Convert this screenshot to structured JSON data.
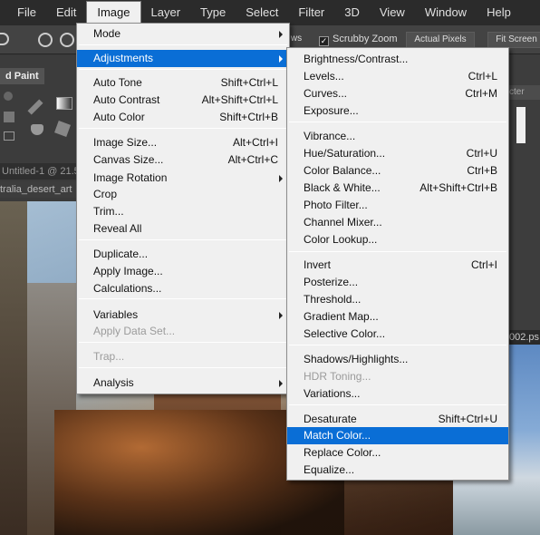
{
  "menubar": {
    "items": [
      "File",
      "Edit",
      "Image",
      "Layer",
      "Type",
      "Select",
      "Filter",
      "3D",
      "View",
      "Window",
      "Help"
    ],
    "open_index": 2
  },
  "options": {
    "fit_label": "ws",
    "scrubby_zoom": "Scrubby Zoom",
    "scrubby_checked": true,
    "actual_pixels": "Actual Pixels",
    "fit_screen": "Fit Screen"
  },
  "left_panel": {
    "tab_label": "d Paint"
  },
  "documents": {
    "tab1": "Untitled-1 @ 21.5",
    "tab2": "tralia_desert_art",
    "right_tab": "002.ps",
    "right_panel_label": "cter"
  },
  "image_menu": {
    "items": [
      {
        "label": "Mode",
        "shortcut": "",
        "submenu": true,
        "disabled": false,
        "highlighted": false
      },
      {
        "label": "Adjustments",
        "shortcut": "",
        "submenu": true,
        "disabled": false,
        "highlighted": true
      },
      {
        "label": "Auto Tone",
        "shortcut": "Shift+Ctrl+L",
        "submenu": false,
        "disabled": false,
        "highlighted": false
      },
      {
        "label": "Auto Contrast",
        "shortcut": "Alt+Shift+Ctrl+L",
        "submenu": false,
        "disabled": false,
        "highlighted": false
      },
      {
        "label": "Auto Color",
        "shortcut": "Shift+Ctrl+B",
        "submenu": false,
        "disabled": false,
        "highlighted": false
      },
      {
        "label": "Image Size...",
        "shortcut": "Alt+Ctrl+I",
        "submenu": false,
        "disabled": false,
        "highlighted": false
      },
      {
        "label": "Canvas Size...",
        "shortcut": "Alt+Ctrl+C",
        "submenu": false,
        "disabled": false,
        "highlighted": false
      },
      {
        "label": "Image Rotation",
        "shortcut": "",
        "submenu": true,
        "disabled": false,
        "highlighted": false
      },
      {
        "label": "Crop",
        "shortcut": "",
        "submenu": false,
        "disabled": false,
        "highlighted": false
      },
      {
        "label": "Trim...",
        "shortcut": "",
        "submenu": false,
        "disabled": false,
        "highlighted": false
      },
      {
        "label": "Reveal All",
        "shortcut": "",
        "submenu": false,
        "disabled": false,
        "highlighted": false
      },
      {
        "label": "Duplicate...",
        "shortcut": "",
        "submenu": false,
        "disabled": false,
        "highlighted": false
      },
      {
        "label": "Apply Image...",
        "shortcut": "",
        "submenu": false,
        "disabled": false,
        "highlighted": false
      },
      {
        "label": "Calculations...",
        "shortcut": "",
        "submenu": false,
        "disabled": false,
        "highlighted": false
      },
      {
        "label": "Variables",
        "shortcut": "",
        "submenu": true,
        "disabled": false,
        "highlighted": false
      },
      {
        "label": "Apply Data Set...",
        "shortcut": "",
        "submenu": false,
        "disabled": true,
        "highlighted": false
      },
      {
        "label": "Trap...",
        "shortcut": "",
        "submenu": false,
        "disabled": true,
        "highlighted": false
      },
      {
        "label": "Analysis",
        "shortcut": "",
        "submenu": true,
        "disabled": false,
        "highlighted": false
      }
    ]
  },
  "adjustments_menu": {
    "items": [
      {
        "label": "Brightness/Contrast...",
        "shortcut": "",
        "disabled": false,
        "highlighted": false
      },
      {
        "label": "Levels...",
        "shortcut": "Ctrl+L",
        "disabled": false,
        "highlighted": false
      },
      {
        "label": "Curves...",
        "shortcut": "Ctrl+M",
        "disabled": false,
        "highlighted": false
      },
      {
        "label": "Exposure...",
        "shortcut": "",
        "disabled": false,
        "highlighted": false
      },
      {
        "label": "Vibrance...",
        "shortcut": "",
        "disabled": false,
        "highlighted": false
      },
      {
        "label": "Hue/Saturation...",
        "shortcut": "Ctrl+U",
        "disabled": false,
        "highlighted": false
      },
      {
        "label": "Color Balance...",
        "shortcut": "Ctrl+B",
        "disabled": false,
        "highlighted": false
      },
      {
        "label": "Black & White...",
        "shortcut": "Alt+Shift+Ctrl+B",
        "disabled": false,
        "highlighted": false
      },
      {
        "label": "Photo Filter...",
        "shortcut": "",
        "disabled": false,
        "highlighted": false
      },
      {
        "label": "Channel Mixer...",
        "shortcut": "",
        "disabled": false,
        "highlighted": false
      },
      {
        "label": "Color Lookup...",
        "shortcut": "",
        "disabled": false,
        "highlighted": false
      },
      {
        "label": "Invert",
        "shortcut": "Ctrl+I",
        "disabled": false,
        "highlighted": false
      },
      {
        "label": "Posterize...",
        "shortcut": "",
        "disabled": false,
        "highlighted": false
      },
      {
        "label": "Threshold...",
        "shortcut": "",
        "disabled": false,
        "highlighted": false
      },
      {
        "label": "Gradient Map...",
        "shortcut": "",
        "disabled": false,
        "highlighted": false
      },
      {
        "label": "Selective Color...",
        "shortcut": "",
        "disabled": false,
        "highlighted": false
      },
      {
        "label": "Shadows/Highlights...",
        "shortcut": "",
        "disabled": false,
        "highlighted": false
      },
      {
        "label": "HDR Toning...",
        "shortcut": "",
        "disabled": true,
        "highlighted": false
      },
      {
        "label": "Variations...",
        "shortcut": "",
        "disabled": false,
        "highlighted": false
      },
      {
        "label": "Desaturate",
        "shortcut": "Shift+Ctrl+U",
        "disabled": false,
        "highlighted": false
      },
      {
        "label": "Match Color...",
        "shortcut": "",
        "disabled": false,
        "highlighted": true
      },
      {
        "label": "Replace Color...",
        "shortcut": "",
        "disabled": false,
        "highlighted": false
      },
      {
        "label": "Equalize...",
        "shortcut": "",
        "disabled": false,
        "highlighted": false
      }
    ]
  },
  "colors": {
    "highlight": "#0a6ed6",
    "menu_bg": "#f0f0f0",
    "app_bg": "#2b2b2b"
  }
}
